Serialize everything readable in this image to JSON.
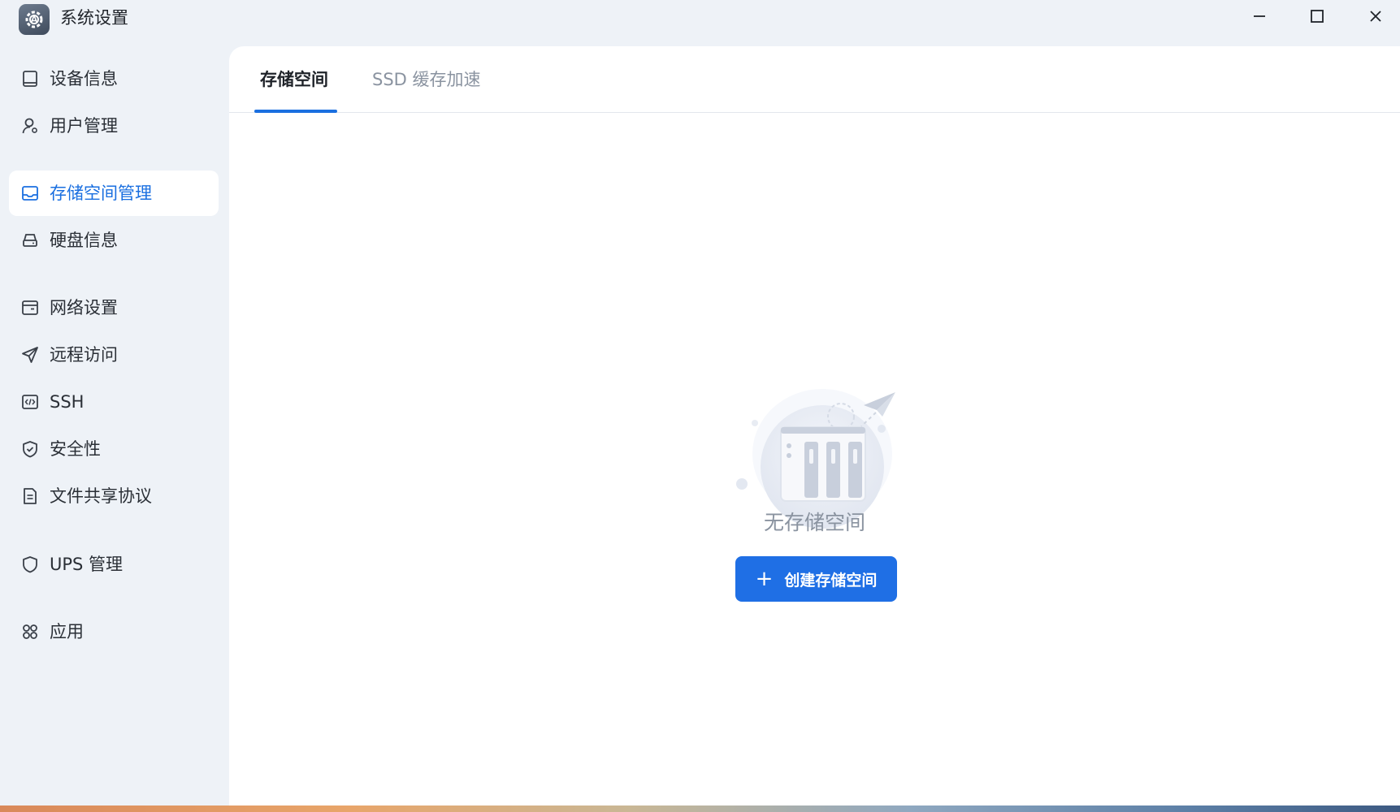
{
  "window": {
    "title": "系统设置",
    "controls": {
      "minimize": "minimize-icon",
      "maximize": "maximize-icon",
      "close": "close-icon"
    }
  },
  "sidebar": {
    "items": [
      {
        "label": "设备信息",
        "icon": "device-icon",
        "active": false
      },
      {
        "label": "用户管理",
        "icon": "user-settings-icon",
        "active": false
      },
      {
        "label": "存储空间管理",
        "icon": "storage-icon",
        "active": true
      },
      {
        "label": "硬盘信息",
        "icon": "disk-icon",
        "active": false
      },
      {
        "label": "网络设置",
        "icon": "network-icon",
        "active": false
      },
      {
        "label": "远程访问",
        "icon": "send-icon",
        "active": false
      },
      {
        "label": "SSH",
        "icon": "code-icon",
        "active": false
      },
      {
        "label": "安全性",
        "icon": "shield-check-icon",
        "active": false
      },
      {
        "label": "文件共享协议",
        "icon": "document-icon",
        "active": false
      },
      {
        "label": "UPS 管理",
        "icon": "shield-icon",
        "active": false
      },
      {
        "label": "应用",
        "icon": "apps-icon",
        "active": false
      }
    ]
  },
  "main": {
    "tabs": [
      {
        "label": "存储空间",
        "active": true
      },
      {
        "label": "SSD 缓存加速",
        "active": false
      }
    ],
    "empty_state": {
      "message": "无存储空间",
      "button_label": "创建存储空间",
      "button_icon": "plus-icon"
    }
  },
  "colors": {
    "accent": "#1f6fe5",
    "sidebar_bg": "#eef2f7",
    "panel_bg": "#ffffff",
    "muted_text": "#8a93a0"
  }
}
